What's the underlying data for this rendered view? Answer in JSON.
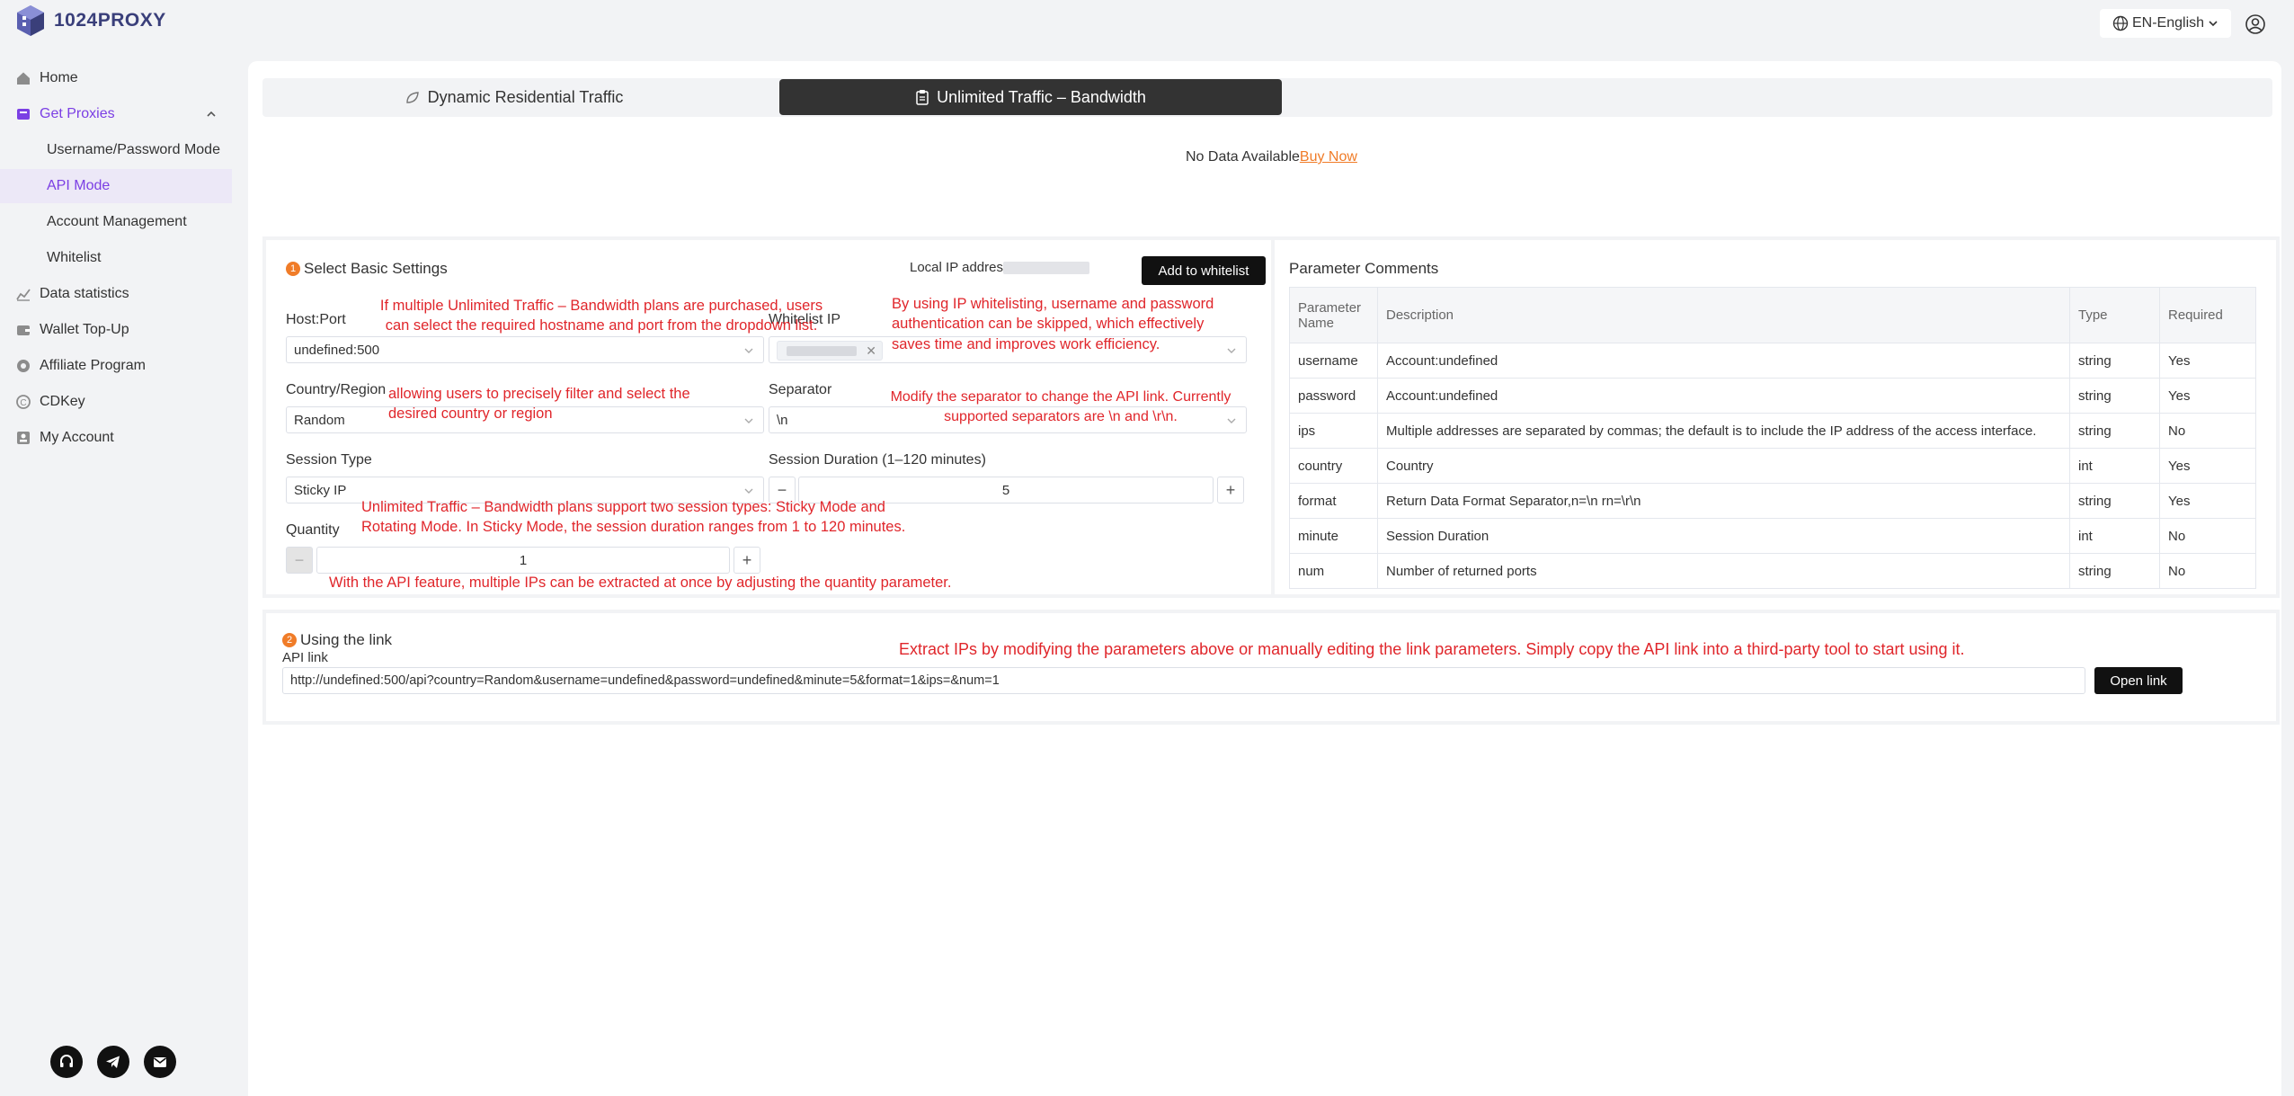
{
  "header": {
    "logo_text": "1024PROXY",
    "language": "EN-English"
  },
  "sidebar": {
    "items": [
      {
        "label": "Home",
        "icon": "home-icon"
      },
      {
        "label": "Get Proxies",
        "icon": "proxy-icon"
      },
      {
        "label": "Username/Password Mode"
      },
      {
        "label": "API Mode"
      },
      {
        "label": "Account Management"
      },
      {
        "label": "Whitelist"
      },
      {
        "label": "Data statistics",
        "icon": "chart-icon"
      },
      {
        "label": "Wallet Top-Up",
        "icon": "wallet-icon"
      },
      {
        "label": "Affiliate Program",
        "icon": "affiliate-icon"
      },
      {
        "label": "CDKey",
        "icon": "key-icon"
      },
      {
        "label": "My Account",
        "icon": "account-icon"
      }
    ]
  },
  "tabs": {
    "dynamic": "Dynamic Residential Traffic",
    "unlimited": "Unlimited Traffic – Bandwidth"
  },
  "nodata": {
    "text": "No Data Available",
    "link": "Buy Now"
  },
  "settings": {
    "step": "1",
    "title": "Select Basic Settings",
    "local_ip_label": "Local IP address:",
    "whitelist_button": "Add to whitelist",
    "host_label": "Host:Port",
    "host_value": "undefined:500",
    "whitelist_label": "Whitelist IP",
    "country_label": "Country/Region",
    "country_value": "Random",
    "separator_label": "Separator",
    "separator_value": "\\n",
    "session_type_label": "Session Type",
    "session_type_value": "Sticky IP",
    "session_duration_label": "Session Duration (1–120 minutes)",
    "session_duration_value": "5",
    "quantity_label": "Quantity",
    "quantity_value": "1",
    "minus": "−",
    "plus": "+",
    "remove_tag": "✕"
  },
  "annotations": {
    "host": "If multiple Unlimited Traffic – Bandwidth plans are purchased, users\ncan select the required hostname and port from the dropdown list.",
    "whitelist": "By using IP whitelisting, username and password\nauthentication can be skipped, which effectively\nsaves time and improves work efficiency.",
    "country": "allowing users to precisely filter and select the\ndesired country or region",
    "separator": "Modify the separator to change the API link. Currently\nsupported separators are \\n and \\r\\n.",
    "session": "Unlimited Traffic – Bandwidth plans support two session types: Sticky Mode and\nRotating Mode. In Sticky Mode, the session duration ranges from 1 to 120 minutes.",
    "quantity": "With the API feature, multiple IPs can be extracted at once by adjusting the quantity parameter.",
    "link": "Extract IPs by modifying the parameters above or manually editing the link parameters. Simply copy the API link into a third-party tool to start using it."
  },
  "params": {
    "title": "Parameter Comments",
    "headers": [
      "Parameter Name",
      "Description",
      "Type",
      "Required"
    ],
    "rows": [
      [
        "username",
        "Account:undefined",
        "string",
        "Yes"
      ],
      [
        "password",
        "Account:undefined",
        "string",
        "Yes"
      ],
      [
        "ips",
        "Multiple addresses are separated by commas; the default is to include the IP address of the access interface.",
        "string",
        "No"
      ],
      [
        "country",
        "Country",
        "int",
        "Yes"
      ],
      [
        "format",
        "Return Data Format Separator,n=\\n rn=\\r\\n",
        "string",
        "Yes"
      ],
      [
        "minute",
        "Session Duration",
        "int",
        "No"
      ],
      [
        "num",
        "Number of returned ports",
        "string",
        "No"
      ]
    ]
  },
  "link": {
    "step": "2",
    "title": "Using the link",
    "api_label": "API link",
    "api_value": "http://undefined:500/api?country=Random&username=undefined&password=undefined&minute=5&format=1&ips=&num=1",
    "open_button": "Open link"
  }
}
